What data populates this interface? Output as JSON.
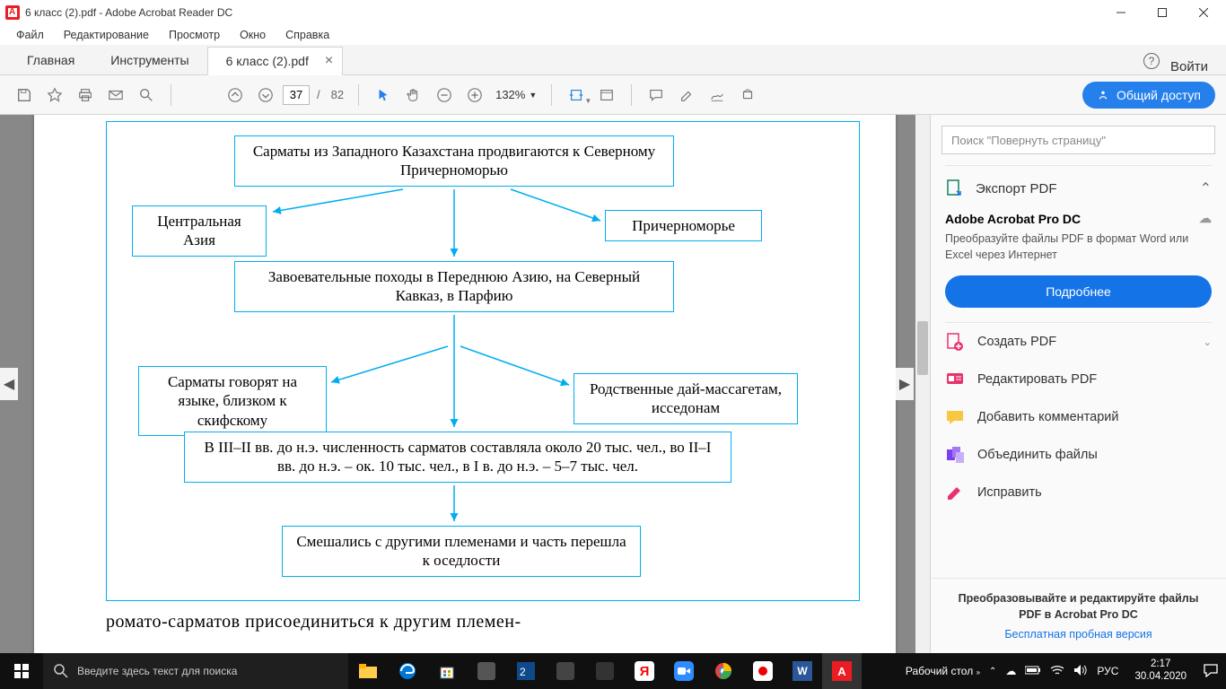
{
  "window": {
    "title": "6 класс (2).pdf - Adobe Acrobat Reader DC"
  },
  "menu": {
    "file": "Файл",
    "edit": "Редактирование",
    "view": "Просмотр",
    "window": "Окно",
    "help": "Справка"
  },
  "tabs": {
    "home": "Главная",
    "tools": "Инструменты",
    "doc": "6 класс (2).pdf",
    "login": "Войти"
  },
  "toolbar": {
    "page_current": "37",
    "page_total": "82",
    "zoom": "132%",
    "share": "Общий доступ"
  },
  "doc": {
    "box1": "Сарматы из Западного Казахстана продвигаются к Северному Причерноморью",
    "box2": "Центральная Азия",
    "box3": "Причерноморье",
    "box4": "Завоевательные походы в Переднюю Азию, на Северный Кавказ, в Парфию",
    "box5": "Сарматы говорят на языке, близком к скифскому",
    "box6": "Родственные дай-массагетам, исседонам",
    "box7": "В III–II вв. до н.э. численность сарматов составляла около 20 тыс. чел., во II–I вв. до н.э. – ок. 10 тыс. чел., в I в. до н.э. – 5–7 тыс. чел.",
    "box8": "Смешались с другими племенами и часть перешла к оседлости",
    "paragraph": "ромато-сарматов присоединиться к другим племен-"
  },
  "sidebar": {
    "search_placeholder": "Поиск \"Повернуть страницу\"",
    "export": "Экспорт PDF",
    "product": "Adobe Acrobat Pro DC",
    "product_desc": "Преобразуйте файлы PDF в формат Word или Excel через Интернет",
    "more_btn": "Подробнее",
    "create": "Создать PDF",
    "edit": "Редактировать PDF",
    "comment": "Добавить комментарий",
    "combine": "Объединить файлы",
    "redact": "Исправить",
    "promo_text": "Преобразовывайте и редактируйте файлы PDF в Acrobat Pro DC",
    "promo_link": "Бесплатная пробная версия"
  },
  "taskbar": {
    "search_placeholder": "Введите здесь текст для поиска",
    "desktop": "Рабочий стол",
    "lang": "РУС",
    "time": "2:17",
    "date": "30.04.2020"
  }
}
